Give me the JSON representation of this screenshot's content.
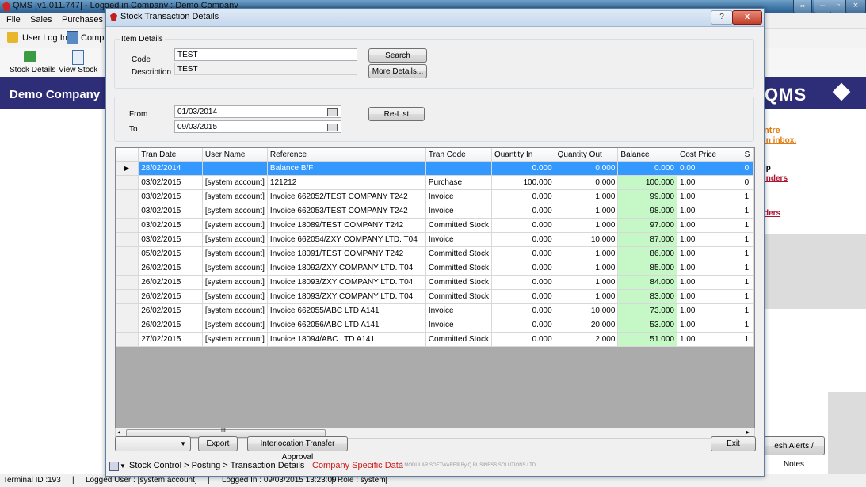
{
  "app": {
    "title": "QMS  [v1.011.747]  -  Logged in Company : Demo Company",
    "menu": [
      "File",
      "Sales",
      "Purchases"
    ],
    "toolbar1": {
      "login_label": "User Log In",
      "comp_label": "Comp"
    },
    "toolbar2": {
      "stock_details": "Stock Details",
      "view_stock": "View Stock"
    },
    "company_name": "Demo Company",
    "logo_text": "QMS",
    "right_panel": {
      "centre": "ntre",
      "inbox": "in inbox.",
      "lp": "lp",
      "inders": "inders",
      "ders": "ders",
      "alerts_button": "esh Alerts / Notes"
    },
    "status": {
      "terminal": "Terminal ID :193",
      "user": "Logged User : [system account]",
      "logged_in": "Logged In : 09/03/2015 13:23:09",
      "role": "Role : system",
      "sep": "|"
    }
  },
  "dialog": {
    "title": "Stock Transaction Details",
    "help": "?",
    "close": "x",
    "item_details": {
      "legend": "Item Details",
      "code_label": "Code",
      "code_value": "TEST",
      "description_label": "Description",
      "description_value": "TEST",
      "search_button": "Search",
      "more_details_button": "More Details..."
    },
    "dates": {
      "from_label": "From",
      "from_value": "01/03/2014",
      "to_label": "To",
      "to_value": "09/03/2015",
      "relist_button": "Re-List"
    },
    "grid": {
      "columns": [
        "Tran Date",
        "User Name",
        "Reference",
        "Tran Code",
        "Quantity In",
        "Quantity Out",
        "Balance",
        "Cost Price",
        "S"
      ],
      "rows": [
        [
          "28/02/2014",
          "",
          "Balance B/F",
          "",
          "0.000",
          "0.000",
          "0.000",
          "0.00",
          "0."
        ],
        [
          "03/02/2015",
          "[system account]",
          "121212",
          "Purchase",
          "100.000",
          "0.000",
          "100.000",
          "1.00",
          "0."
        ],
        [
          "03/02/2015",
          "[system account]",
          "Invoice 662052/TEST COMPANY T242",
          "Invoice",
          "0.000",
          "1.000",
          "99.000",
          "1.00",
          "1."
        ],
        [
          "03/02/2015",
          "[system account]",
          "Invoice 662053/TEST COMPANY T242",
          "Invoice",
          "0.000",
          "1.000",
          "98.000",
          "1.00",
          "1."
        ],
        [
          "03/02/2015",
          "[system account]",
          "Invoice 18089/TEST COMPANY T242",
          "Committed Stock",
          "0.000",
          "1.000",
          "97.000",
          "1.00",
          "1."
        ],
        [
          "03/02/2015",
          "[system account]",
          "Invoice 662054/ZXY COMPANY LTD. T04",
          "Invoice",
          "0.000",
          "10.000",
          "87.000",
          "1.00",
          "1."
        ],
        [
          "05/02/2015",
          "[system account]",
          "Invoice 18091/TEST COMPANY T242",
          "Committed Stock",
          "0.000",
          "1.000",
          "86.000",
          "1.00",
          "1."
        ],
        [
          "26/02/2015",
          "[system account]",
          "Invoice 18092/ZXY COMPANY LTD. T04",
          "Committed Stock",
          "0.000",
          "1.000",
          "85.000",
          "1.00",
          "1."
        ],
        [
          "26/02/2015",
          "[system account]",
          "Invoice 18093/ZXY COMPANY LTD. T04",
          "Committed Stock",
          "0.000",
          "1.000",
          "84.000",
          "1.00",
          "1."
        ],
        [
          "26/02/2015",
          "[system account]",
          "Invoice 18093/ZXY COMPANY LTD. T04",
          "Committed Stock",
          "0.000",
          "1.000",
          "83.000",
          "1.00",
          "1."
        ],
        [
          "26/02/2015",
          "[system account]",
          "Invoice 662055/ABC LTD A141",
          "Invoice",
          "0.000",
          "10.000",
          "73.000",
          "1.00",
          "1."
        ],
        [
          "26/02/2015",
          "[system account]",
          "Invoice 662056/ABC LTD A141",
          "Invoice",
          "0.000",
          "20.000",
          "53.000",
          "1.00",
          "1."
        ],
        [
          "27/02/2015",
          "[system account]",
          "Invoice 18094/ABC LTD A141",
          "Committed Stock",
          "0.000",
          "2.000",
          "51.000",
          "1.00",
          "1."
        ]
      ],
      "scroll_thumb_mark": "III"
    },
    "footer": {
      "export_button": "Export",
      "interlocation_button": "Interlocation Transfer Approval",
      "exit_button": "Exit"
    },
    "status": {
      "breadcrumb": "Stock Control > Posting > Transaction Details",
      "sep": "|",
      "company_specific": "Company Specific Data",
      "vendor": "Q MODULAR SOFTWARE® By Q BUSINESS SOLUTIONS LTD"
    }
  },
  "colors": {
    "company_bar": "#2e2d77",
    "selected_row": "#3399ff",
    "balance_cell": "#c6f7c6",
    "company_specific": "#d01818"
  }
}
